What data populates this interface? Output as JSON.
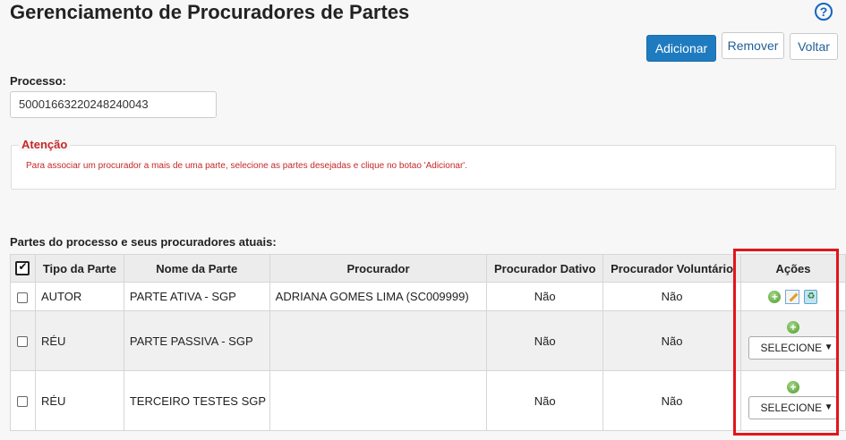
{
  "page": {
    "title": "Gerenciamento de Procuradores de Partes",
    "help_glyph": "?"
  },
  "toolbar": {
    "add_label": "Adicionar",
    "remove_label": "Remover",
    "back_label": "Voltar"
  },
  "process": {
    "label": "Processo:",
    "value": "50001663220248240043"
  },
  "attention": {
    "legend": "Atenção",
    "message": "Para associar um procurador a mais de uma parte, selecione as partes desejadas e clique no botao 'Adicionar'."
  },
  "table": {
    "caption": "Partes do processo e seus procuradores atuais:",
    "headers": [
      "Tipo da Parte",
      "Nome da Parte",
      "Procurador",
      "Procurador Dativo",
      "Procurador Voluntário",
      "Ações"
    ],
    "rows": [
      {
        "tipo": "AUTOR",
        "nome": "PARTE ATIVA - SGP",
        "procurador": "ADRIANA GOMES LIMA (SC009999)",
        "dativo": "Não",
        "voluntario": "Não"
      },
      {
        "tipo": "RÉU",
        "nome": "PARTE PASSIVA - SGP",
        "procurador": "",
        "dativo": "Não",
        "voluntario": "Não",
        "select": "SELECIONE"
      },
      {
        "tipo": "RÉU",
        "nome": "TERCEIRO TESTES SGP",
        "procurador": "",
        "dativo": "Não",
        "voluntario": "Não",
        "select": "SELECIONE"
      }
    ]
  },
  "icons": {
    "add": "plus-circle-icon",
    "edit": "edit-icon",
    "delete": "recycle-delete-icon"
  },
  "colors": {
    "primary": "#1f7bbf",
    "attention": "#c62828",
    "highlight": "#e0161b"
  }
}
